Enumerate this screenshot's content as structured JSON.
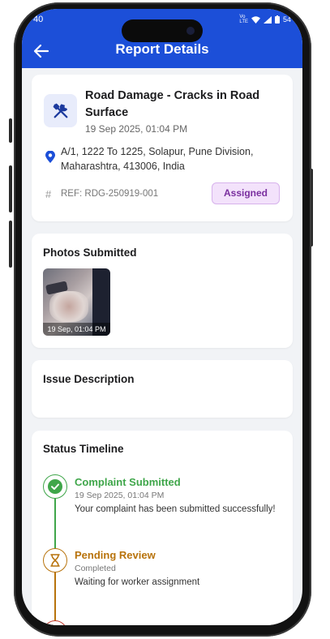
{
  "status_bar": {
    "time": "40",
    "battery": "54"
  },
  "header": {
    "title": "Report Details"
  },
  "report": {
    "title": "Road Damage - Cracks in Road Surface",
    "date": "19 Sep 2025, 01:04 PM",
    "address": "A/1, 1222 To 1225, Solapur, Pune Division, Maharashtra, 413006, India",
    "ref": "REF: RDG-250919-001",
    "status_badge": "Assigned"
  },
  "photos": {
    "title": "Photos Submitted",
    "items": [
      {
        "timestamp": "19 Sep, 01:04 PM"
      }
    ]
  },
  "description": {
    "title": "Issue Description"
  },
  "timeline": {
    "title": "Status Timeline",
    "events": [
      {
        "title": "Complaint Submitted",
        "subtitle": "19 Sep 2025, 01:04 PM",
        "desc": "Your complaint has been submitted successfully!",
        "color": "#3fa64a",
        "icon": "check-circle-icon"
      },
      {
        "title": "Pending Review",
        "subtitle": "Completed",
        "desc": "Waiting for worker assignment",
        "color": "#b8730c",
        "icon": "hourglass-icon"
      }
    ]
  },
  "colors": {
    "primary": "#1c4fd8",
    "badge_bg": "#f3e2fb",
    "badge_text": "#7a2f9f"
  }
}
